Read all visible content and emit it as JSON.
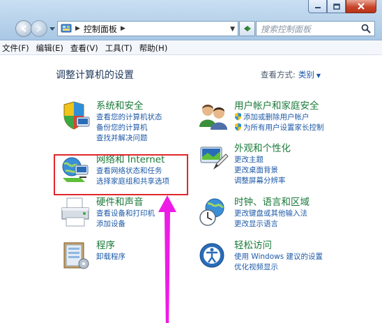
{
  "window": {
    "buttons": [
      "minimize",
      "maximize",
      "close"
    ]
  },
  "address_bar": {
    "crumb": "控制面板",
    "search_placeholder": "搜索控制面板"
  },
  "menu": [
    "文件(F)",
    "编辑(E)",
    "查看(V)",
    "工具(T)",
    "帮助(H)"
  ],
  "content": {
    "title": "调整计算机的设置",
    "view_by_label": "查看方式:",
    "view_by_value": "类别"
  },
  "categories": [
    {
      "title": "系统和安全",
      "icon": "shield-computer-icon",
      "links": [
        "查看您的计算机状态",
        "备份您的计算机",
        "查找并解决问题"
      ]
    },
    {
      "title": "网络和 Internet",
      "icon": "network-globe-icon",
      "links": [
        "查看网络状态和任务",
        "选择家庭组和共享选项"
      ]
    },
    {
      "title": "硬件和声音",
      "icon": "printer-icon",
      "links": [
        "查看设备和打印机",
        "添加设备"
      ]
    },
    {
      "title": "程序",
      "icon": "programs-icon",
      "links": [
        "卸载程序"
      ]
    },
    {
      "title": "用户帐户和家庭安全",
      "icon": "users-icon",
      "links": [
        "添加或删除用户帐户",
        "为所有用户设置家长控制"
      ]
    },
    {
      "title": "外观和个性化",
      "icon": "appearance-icon",
      "links": [
        "更改主题",
        "更改桌面背景",
        "调整屏幕分辨率"
      ]
    },
    {
      "title": "时钟、语言和区域",
      "icon": "clock-globe-icon",
      "links": [
        "更改键盘或其他输入法",
        "更改显示语言"
      ]
    },
    {
      "title": "轻松访问",
      "icon": "ease-of-access-icon",
      "links": [
        "使用 Windows 建议的设置",
        "优化视频显示"
      ]
    }
  ],
  "annotation": {
    "highlight_color": "#e0262b",
    "arrow_color": "#ee1be6"
  }
}
